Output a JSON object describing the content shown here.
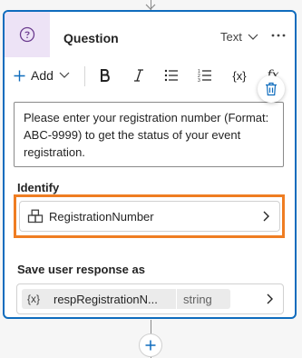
{
  "node": {
    "title": "Question",
    "response_type": "Text"
  },
  "toolbar": {
    "add_label": "Add"
  },
  "message": {
    "text": "Please enter your registration number (Format: ABC-9999) to get the status of your event registration."
  },
  "identify": {
    "label": "Identify",
    "entity": "RegistrationNumber"
  },
  "save_response": {
    "label": "Save user response as",
    "variable_prefix": "{x}",
    "variable_name": "respRegistrationN...",
    "variable_type": "string"
  },
  "colors": {
    "accent": "#0f6cbd",
    "highlight": "#ef7d22",
    "icon_bg": "#ede3f6"
  },
  "icons": [
    "chat-bubble-question-icon",
    "chevron-down-icon",
    "more-options-icon",
    "plus-icon",
    "bold-icon",
    "italic-icon",
    "bulleted-list-icon",
    "numbered-list-icon",
    "variable-icon",
    "formula-icon",
    "trash-icon",
    "entity-icon",
    "chevron-right-icon"
  ]
}
